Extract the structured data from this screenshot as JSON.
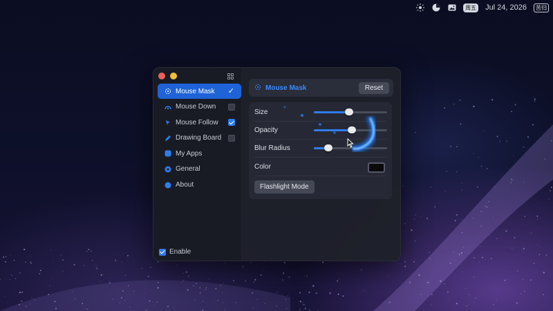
{
  "menubar": {
    "icons": [
      "brightness-icon",
      "pie-chart-icon",
      "photo-icon"
    ],
    "badge_left": "周五",
    "date": "Jul 24, 2026",
    "badge_right": "苦归"
  },
  "sidebar": {
    "items": [
      {
        "label": "Mouse Mask",
        "icon": "mouse-mask-icon",
        "active": true,
        "checked": true
      },
      {
        "label": "Mouse Down",
        "icon": "mouse-down-icon",
        "active": false,
        "checked": false
      },
      {
        "label": "Mouse Follow",
        "icon": "mouse-follow-icon",
        "active": false,
        "checked": true
      },
      {
        "label": "Drawing Board",
        "icon": "drawing-board-icon",
        "active": false,
        "checked": false
      },
      {
        "label": "My Apps",
        "icon": "apps-icon",
        "active": false
      },
      {
        "label": "General",
        "icon": "gear-icon",
        "active": false
      },
      {
        "label": "About",
        "icon": "info-icon",
        "active": false
      }
    ],
    "enable_label": "Enable",
    "enable_checked": true
  },
  "content": {
    "title": "Mouse Mask",
    "reset_label": "Reset",
    "settings": {
      "size_label": "Size",
      "size_value": 0.48,
      "opacity_label": "Opacity",
      "opacity_value": 0.52,
      "blur_label": "Blur Radius",
      "blur_value": 0.2,
      "color_label": "Color",
      "color_value": "#0a0a0c"
    },
    "flashlight_label": "Flashlight Mode"
  },
  "colors": {
    "accent": "#2f7cf2",
    "active_bg": "#1e63d8",
    "title_blue": "#3b8bff"
  }
}
